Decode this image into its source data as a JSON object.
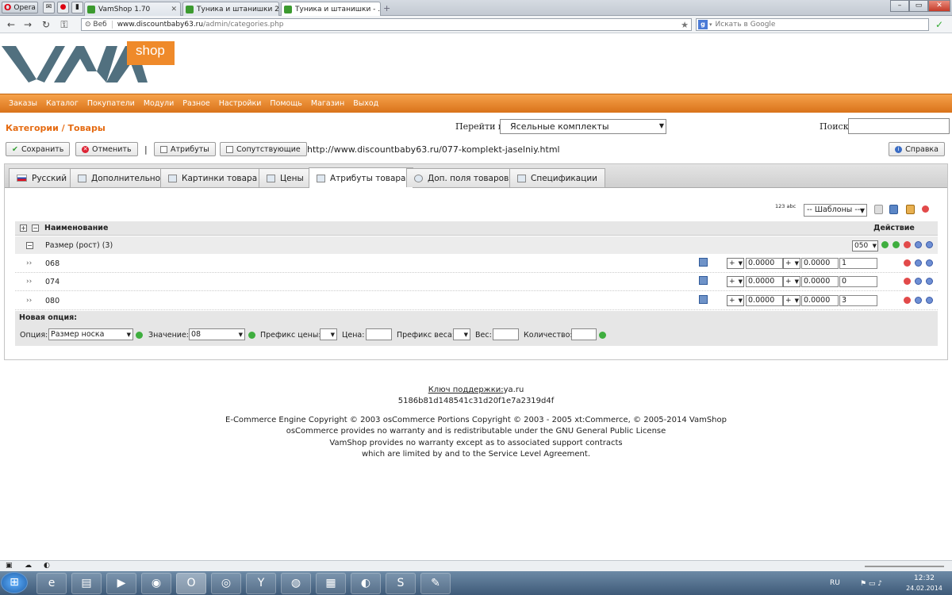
{
  "browser": {
    "menu_label": "Opera",
    "tabs": [
      {
        "label": "VamShop 1.70"
      },
      {
        "label": "Туника и штанишки 2..."
      },
      {
        "label": "Туника и штанишки - ..."
      }
    ],
    "address_prefix": "Веб",
    "address_host": "www.discountbaby63.ru",
    "address_path": "/admin/categories.php",
    "search_placeholder": "Искать в Google"
  },
  "logo": {
    "text": "VAM",
    "badge": "shop"
  },
  "menu": [
    "Заказы",
    "Каталог",
    "Покупатели",
    "Модули",
    "Разное",
    "Настройки",
    "Помощь",
    "Магазин",
    "Выход"
  ],
  "page": {
    "title": "Категории / Товары",
    "goto_label": "Перейти в:",
    "goto_value": "Ясельные комплекты",
    "search_label": "Поиск:"
  },
  "toolbar": {
    "save": "Сохранить",
    "cancel": "Отменить",
    "separator": "|",
    "attributes": "Атрибуты",
    "related": "Сопутствующие",
    "url": "http://www.discountbaby63.ru/077-komplekt-jaselniy.html",
    "help": "Справка"
  },
  "tabs": [
    "Русский",
    "Дополнительно",
    "Картинки товара",
    "Цены",
    "Атрибуты товара",
    "Доп. поля товаров",
    "Спецификации"
  ],
  "attributes": {
    "sort_label": "123 abc",
    "templates": "-- Шаблоны --",
    "col_name": "Наименование",
    "col_action": "Действие",
    "group": {
      "label": "Размер (рост) (3)",
      "sort": "050"
    },
    "values": [
      {
        "name": "068",
        "prefix1": "+",
        "price": "0.0000",
        "prefix2": "+",
        "weight": "0.0000",
        "qty": "1"
      },
      {
        "name": "074",
        "prefix1": "+",
        "price": "0.0000",
        "prefix2": "+",
        "weight": "0.0000",
        "qty": "0"
      },
      {
        "name": "080",
        "prefix1": "+",
        "price": "0.0000",
        "prefix2": "+",
        "weight": "0.0000",
        "qty": "3"
      }
    ],
    "new_option": {
      "title": "Новая опция:",
      "option_label": "Опция:",
      "option_value": "Размер носка",
      "value_label": "Значение:",
      "value_value": "08",
      "price_prefix_label": "Префикс цены:",
      "price_label": "Цена:",
      "weight_prefix_label": "Префикс веса:",
      "weight_label": "Вес:",
      "qty_label": "Количество:"
    }
  },
  "footer": {
    "support_label": "Ключ поддержки:",
    "support_link": "ya.ru",
    "support_key": "5186b81d148541c31d20f1e7a2319d4f",
    "lines": [
      "E-Commerce Engine Copyright © 2003 osCommerce Portions Copyright © 2003 - 2005 xt:Commerce, © 2005-2014 VamShop",
      "osCommerce provides no warranty and is redistributable under the GNU General Public License",
      "VamShop provides no warranty except as to associated support contracts",
      "which are limited by and to the Service Level Agreement."
    ]
  },
  "taskbar": {
    "lang": "RU",
    "time": "12:32",
    "date": "24.02.2014"
  },
  "colors": {
    "accent": "#e56b12",
    "menu": "#e8821f",
    "logo_gray": "#4f6b7a"
  }
}
